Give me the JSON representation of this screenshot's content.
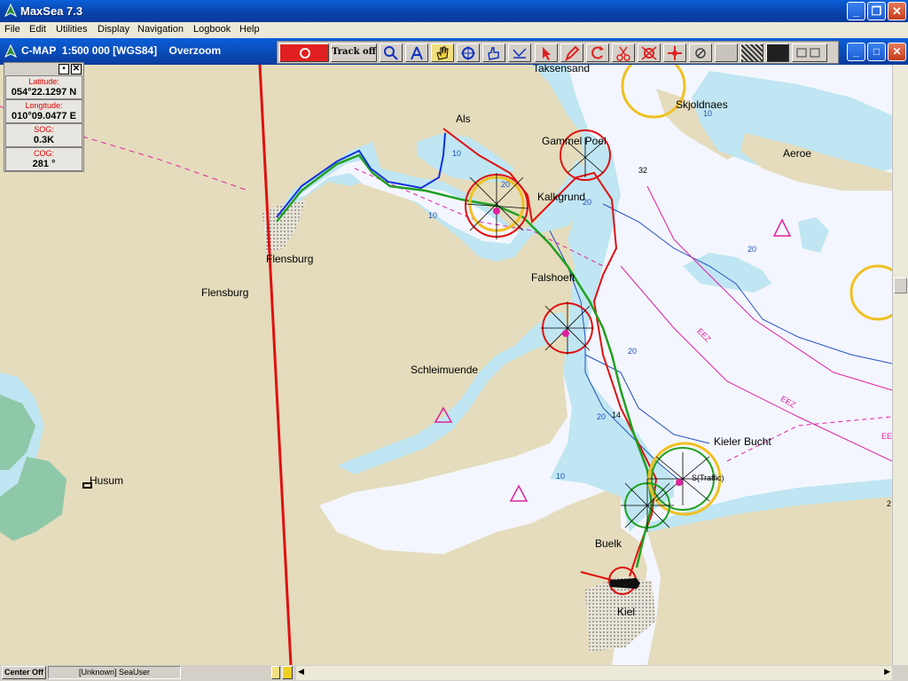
{
  "window": {
    "title": "MaxSea 7.3",
    "min": "_",
    "max": "□",
    "close": "✕"
  },
  "menu": [
    "File",
    "Edit",
    "Utilities",
    "Display",
    "Navigation",
    "Logbook",
    "Help"
  ],
  "chart_window": {
    "title": "C-MAP  1:500 000 [WGS84]    Overzoom"
  },
  "toolbar": {
    "track_label": "Track off"
  },
  "info_panel": {
    "latitude_label": "Latitude:",
    "latitude": "054°22.1297 N",
    "longitude_label": "Longitude:",
    "longitude": "010°09.0477 E",
    "sog_label": "SOG:",
    "sog": "0.3K",
    "cog_label": "COG:",
    "cog": "281 °"
  },
  "places": {
    "taksensand": "Taksensand",
    "skjoldnaes": "Skjoldnaes",
    "als": "Als",
    "gammel_poel": "Gammel Poel",
    "aeroe": "Aeroe",
    "kalkgrund": "Kalkgrund",
    "flensburg1": "Flensburg",
    "flensburg2": "Flensburg",
    "falshoeft": "Falshoeft",
    "schleimuende": "Schleimuende",
    "kieler_bucht": "Kieler Bucht",
    "husum": "Husum",
    "buelk": "Buelk",
    "kiel": "Kiel",
    "traffic": "S(Traffic)"
  },
  "depths": {
    "d32": "32",
    "d20a": "20",
    "d20b": "20",
    "d20c": "20",
    "d20d": "20",
    "d10a": "10",
    "d10b": "10",
    "d10c": "10",
    "d10d": "10",
    "d14": "14",
    "d20e": "20",
    "d2": "2"
  },
  "zones": {
    "eez1": "EEZ",
    "eez2": "EEZ",
    "eez3": "EE"
  },
  "status": {
    "center_off": "Center Off",
    "user": "[Unknown] SeaUser"
  }
}
